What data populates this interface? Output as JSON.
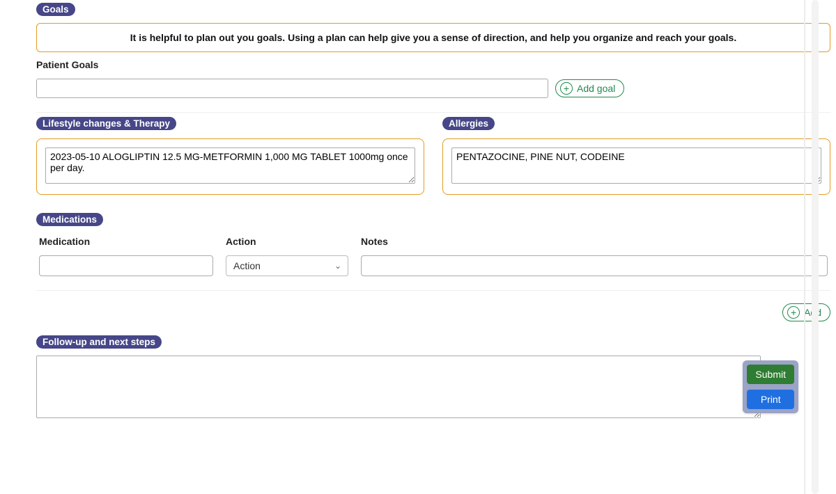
{
  "goals": {
    "section_label": "Goals",
    "info_text": "It is helpful to plan out you goals. Using a plan can help give you a sense of direction, and help you organize and reach your goals.",
    "patient_goals_label": "Patient Goals",
    "input_value": "",
    "add_label": "Add goal"
  },
  "lifestyle": {
    "section_label": "Lifestyle changes & Therapy",
    "value": "2023-05-10 ALOGLIPTIN 12.5 MG-METFORMIN 1,000 MG TABLET 1000mg once per day."
  },
  "allergies": {
    "section_label": "Allergies",
    "value": "PENTAZOCINE, PINE NUT, CODEINE"
  },
  "medications": {
    "section_label": "Medications",
    "col_medication": "Medication",
    "col_action": "Action",
    "col_notes": "Notes",
    "action_placeholder": "Action",
    "add_label": "Add"
  },
  "followup": {
    "section_label": "Follow-up and next steps",
    "value": ""
  },
  "float": {
    "submit_label": "Submit",
    "print_label": "Print"
  }
}
